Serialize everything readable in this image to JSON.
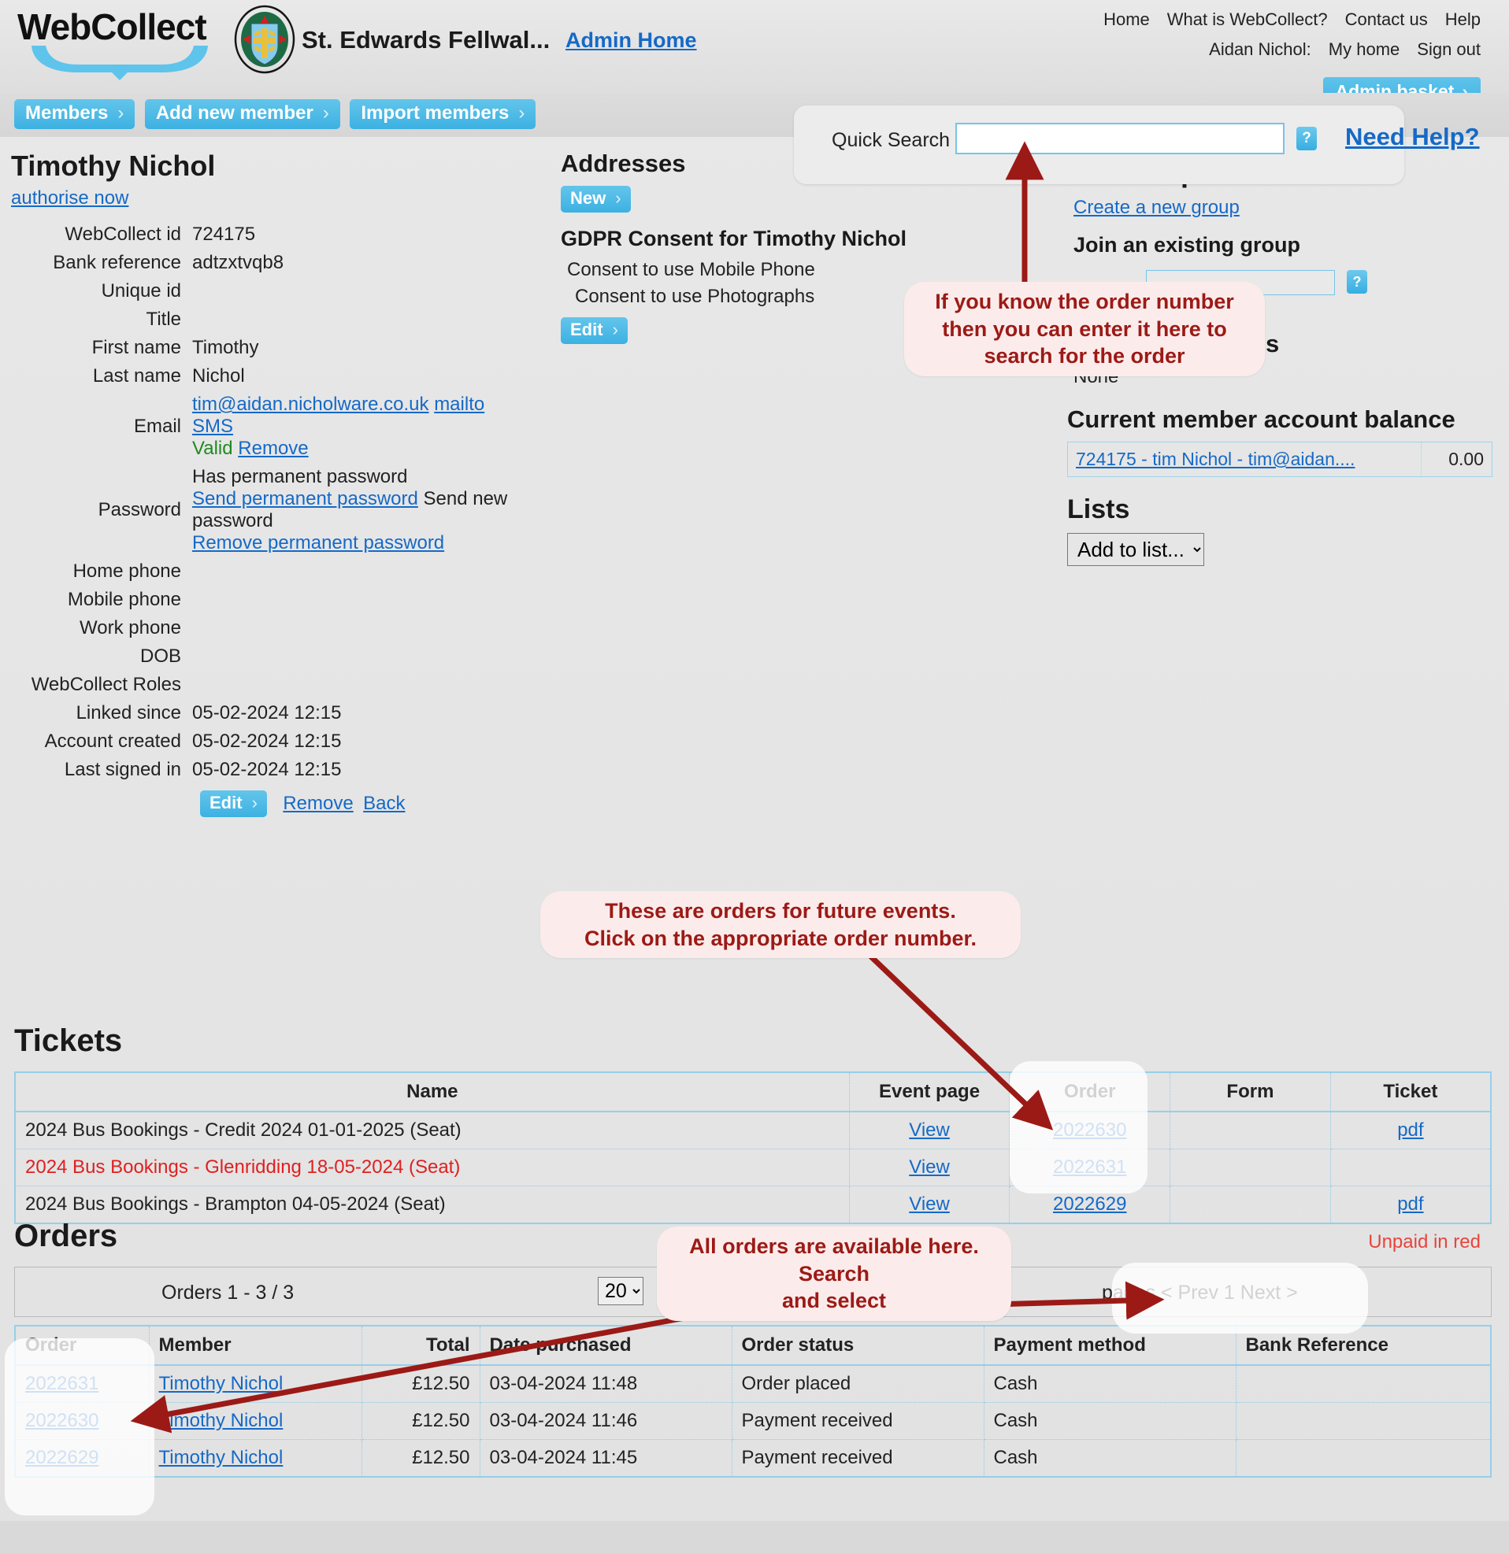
{
  "header": {
    "logo_text": "WebCollect",
    "org_name": "St. Edwards Fellwal...",
    "admin_home": "Admin Home",
    "nav_primary": [
      "Home",
      "What is WebCollect?",
      "Contact us",
      "Help"
    ],
    "user_label": "Aidan Nichol:",
    "nav_user": [
      "My home",
      "Sign out"
    ],
    "admin_basket": "Admin basket",
    "chevron": "›"
  },
  "buttonbar": {
    "items": [
      "Members",
      "Add new member",
      "Import members"
    ]
  },
  "quick_search": {
    "label": "Quick Search",
    "value": "",
    "placeholder": "",
    "help_glyph": "?",
    "need_help": "Need Help?"
  },
  "member": {
    "name": "Timothy Nichol",
    "authorise_link": "authorise now",
    "fields": [
      {
        "label": "WebCollect id",
        "value": "724175"
      },
      {
        "label": "Bank reference",
        "value": "adtzxtvqb8"
      },
      {
        "label": "Unique id",
        "value": ""
      },
      {
        "label": "Title",
        "value": ""
      },
      {
        "label": "First name",
        "value": "Timothy"
      },
      {
        "label": "Last name",
        "value": "Nichol"
      }
    ],
    "email": {
      "label": "Email",
      "address": "tim@aidan.nicholware.co.uk",
      "mailto": "mailto",
      "sms": "SMS",
      "valid": "Valid",
      "remove": "Remove"
    },
    "password": {
      "label": "Password",
      "status": "Has permanent password",
      "send_permanent": "Send permanent password",
      "send_new": "Send new password",
      "remove_permanent": "Remove permanent password"
    },
    "fields2": [
      {
        "label": "Home phone",
        "value": ""
      },
      {
        "label": "Mobile phone",
        "value": ""
      },
      {
        "label": "Work phone",
        "value": ""
      },
      {
        "label": "DOB",
        "value": ""
      },
      {
        "label": "WebCollect Roles",
        "value": ""
      },
      {
        "label": "Linked since",
        "value": "05-02-2024 12:15"
      },
      {
        "label": "Account created",
        "value": "05-02-2024 12:15"
      },
      {
        "label": "Last signed in",
        "value": "05-02-2024 12:15"
      }
    ],
    "actions": {
      "edit": "Edit",
      "remove": "Remove",
      "back": "Back"
    }
  },
  "addresses": {
    "title": "Addresses",
    "new_button": "New",
    "gdpr_title": "GDPR Consent for Timothy Nichol",
    "consents": [
      "Consent to use Mobile Phone",
      "Consent to use Photographs"
    ],
    "edit_button": "Edit"
  },
  "groups": {
    "title": "No Group",
    "create_link": "Create a new group",
    "join_title": "Join an existing group",
    "search_value": "",
    "help_glyph": "?"
  },
  "gocardless": {
    "title": "GoCardless Auths",
    "value": "None"
  },
  "balance": {
    "title": "Current member account balance",
    "account_link": "724175 - tim Nichol - tim@aidan....",
    "amount": "0.00"
  },
  "lists": {
    "title": "Lists",
    "select_value": "Add to list...",
    "options": [
      "Add to list..."
    ]
  },
  "tickets": {
    "title": "Tickets",
    "columns": [
      "Name",
      "Event page",
      "Order",
      "Form",
      "Ticket"
    ],
    "rows": [
      {
        "name": "2024 Bus Bookings - Credit 2024 01-01-2025 (Seat)",
        "event_page": "View",
        "order": "2022630",
        "form": "",
        "ticket": "pdf",
        "unpaid": false
      },
      {
        "name": "2024 Bus Bookings - Glenridding 18-05-2024 (Seat)",
        "event_page": "View",
        "order": "2022631",
        "form": "",
        "ticket": "",
        "unpaid": true
      },
      {
        "name": "2024 Bus Bookings - Brampton 04-05-2024 (Seat)",
        "event_page": "View",
        "order": "2022629",
        "form": "",
        "ticket": "pdf",
        "unpaid": false
      }
    ]
  },
  "orders": {
    "title": "Orders",
    "unpaid_note": "Unpaid in red",
    "count_text": "Orders 1 - 3 / 3",
    "per_page_value": "20",
    "per_page_options": [
      "20"
    ],
    "per_page_label": "per page",
    "pages_label": "pages",
    "pager": {
      "prev": "< Prev",
      "current": "1",
      "next": "Next >"
    },
    "columns": [
      "Order",
      "Member",
      "Total",
      "Date purchased",
      "Order status",
      "Payment method",
      "Bank Reference"
    ],
    "rows": [
      {
        "order": "2022631",
        "member": "Timothy Nichol",
        "total": "£12.50",
        "date": "03-04-2024 11:48",
        "status": "Order placed",
        "payment": "Cash",
        "bank_ref": ""
      },
      {
        "order": "2022630",
        "member": "Timothy Nichol",
        "total": "£12.50",
        "date": "03-04-2024 11:46",
        "status": "Payment received",
        "payment": "Cash",
        "bank_ref": ""
      },
      {
        "order": "2022629",
        "member": "Timothy Nichol",
        "total": "£12.50",
        "date": "03-04-2024 11:45",
        "status": "Payment received",
        "payment": "Cash",
        "bank_ref": ""
      }
    ]
  },
  "annotations": [
    {
      "id": "quick-search-note",
      "lines": [
        "If you know the order number",
        "then you can enter it here  to",
        "search for the order"
      ]
    },
    {
      "id": "tickets-orders-note",
      "lines": [
        "These are orders for future events.",
        "Click on the appropriate order number."
      ]
    },
    {
      "id": "all-orders-note",
      "lines": [
        "All orders are available here.",
        "Search",
        "and select"
      ]
    }
  ],
  "colors": {
    "accent_blue": "#3fb3e3",
    "link_blue": "#1569c7",
    "annotation_red": "#9c1a16",
    "unpaid_red": "#e02020",
    "valid_green": "#1f8a1f",
    "page_bg": "#e4e4e4"
  }
}
